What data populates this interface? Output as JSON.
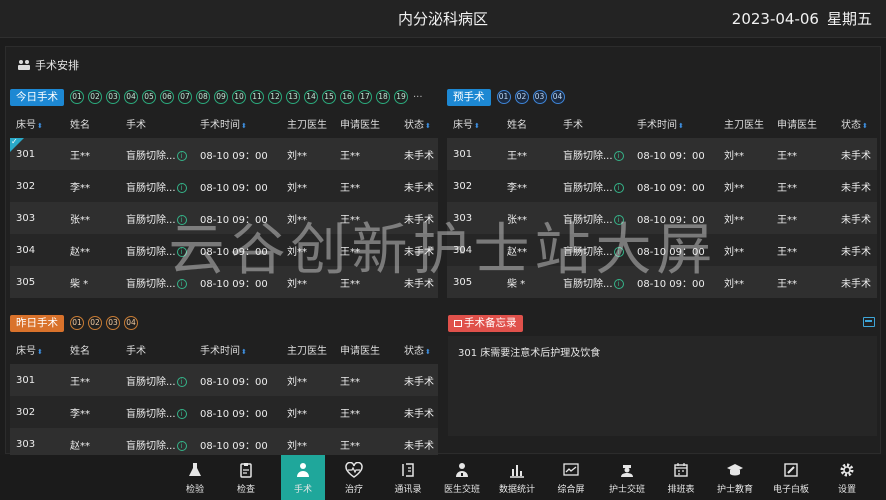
{
  "header": {
    "title": "内分泌科病区",
    "date": "2023-04-06",
    "weekday": "星期五"
  },
  "section_title": "手术安排",
  "columns": {
    "bed": "床号",
    "name": "姓名",
    "surgery": "手术",
    "time": "手术时间",
    "surgeon": "主刀医生",
    "applicant": "申请医生",
    "status": "状态"
  },
  "today": {
    "label": "今日手术",
    "pages": [
      "01",
      "02",
      "03",
      "04",
      "05",
      "06",
      "07",
      "08",
      "09",
      "10",
      "11",
      "12",
      "13",
      "14",
      "15",
      "16",
      "17",
      "18",
      "19"
    ],
    "more": "···",
    "rows": [
      {
        "bed": "301",
        "name": "王**",
        "surgery": "盲肠切除...",
        "time": "08-10 09：00",
        "surgeon": "刘**",
        "applicant": "王**",
        "status": "未手术"
      },
      {
        "bed": "302",
        "name": "李**",
        "surgery": "盲肠切除...",
        "time": "08-10 09：00",
        "surgeon": "刘**",
        "applicant": "王**",
        "status": "未手术"
      },
      {
        "bed": "303",
        "name": "张**",
        "surgery": "盲肠切除...",
        "time": "08-10 09：00",
        "surgeon": "刘**",
        "applicant": "王**",
        "status": "未手术"
      },
      {
        "bed": "304",
        "name": "赵**",
        "surgery": "盲肠切除...",
        "time": "08-10 09：00",
        "surgeon": "刘**",
        "applicant": "王**",
        "status": "未手术"
      },
      {
        "bed": "305",
        "name": "柴 *",
        "surgery": "盲肠切除...",
        "time": "08-10 09：00",
        "surgeon": "刘**",
        "applicant": "王**",
        "status": "未手术"
      }
    ]
  },
  "planned": {
    "label": "预手术",
    "pages": [
      "01",
      "02",
      "03",
      "04"
    ],
    "rows": [
      {
        "bed": "301",
        "name": "王**",
        "surgery": "盲肠切除...",
        "time": "08-10 09：00",
        "surgeon": "刘**",
        "applicant": "王**",
        "status": "未手术"
      },
      {
        "bed": "302",
        "name": "李**",
        "surgery": "盲肠切除...",
        "time": "08-10 09：00",
        "surgeon": "刘**",
        "applicant": "王**",
        "status": "未手术"
      },
      {
        "bed": "303",
        "name": "张**",
        "surgery": "盲肠切除...",
        "time": "08-10 09：00",
        "surgeon": "刘**",
        "applicant": "王**",
        "status": "未手术"
      },
      {
        "bed": "304",
        "name": "赵**",
        "surgery": "盲肠切除...",
        "time": "08-10 09：00",
        "surgeon": "刘**",
        "applicant": "王**",
        "status": "未手术"
      },
      {
        "bed": "305",
        "name": "柴 *",
        "surgery": "盲肠切除...",
        "time": "08-10 09：00",
        "surgeon": "刘**",
        "applicant": "王**",
        "status": "未手术"
      }
    ]
  },
  "yesterday": {
    "label": "昨日手术",
    "pages": [
      "01",
      "02",
      "03",
      "04"
    ],
    "rows": [
      {
        "bed": "301",
        "name": "王**",
        "surgery": "盲肠切除...",
        "time": "08-10 09：00",
        "surgeon": "刘**",
        "applicant": "王**",
        "status": "未手术"
      },
      {
        "bed": "302",
        "name": "李**",
        "surgery": "盲肠切除...",
        "time": "08-10 09：00",
        "surgeon": "刘**",
        "applicant": "王**",
        "status": "未手术"
      },
      {
        "bed": "303",
        "name": "赵**",
        "surgery": "盲肠切除...",
        "time": "08-10 09：00",
        "surgeon": "刘**",
        "applicant": "王**",
        "status": "未手术"
      }
    ]
  },
  "memo": {
    "label": "手术备忘录",
    "text": "301 床需要注意术后护理及饮食"
  },
  "watermark": "云谷创新护士站大屏",
  "nav": [
    {
      "id": "lab",
      "label": "检验",
      "icon": "flask-icon"
    },
    {
      "id": "exam",
      "label": "检查",
      "icon": "clipboard-icon"
    },
    {
      "id": "surgery",
      "label": "手术",
      "icon": "surgeon-icon",
      "active": true
    },
    {
      "id": "treatment",
      "label": "治疗",
      "icon": "heartbeat-icon"
    },
    {
      "id": "contacts",
      "label": "通讯录",
      "icon": "address-book-icon"
    },
    {
      "id": "doctor-handover",
      "label": "医生交班",
      "icon": "doctor-icon"
    },
    {
      "id": "stats",
      "label": "数据统计",
      "icon": "bar-chart-icon"
    },
    {
      "id": "overview",
      "label": "综合屏",
      "icon": "line-chart-icon"
    },
    {
      "id": "nurse-handover",
      "label": "护士交班",
      "icon": "nurse-icon"
    },
    {
      "id": "schedule",
      "label": "排班表",
      "icon": "calendar-icon"
    },
    {
      "id": "education",
      "label": "护士教育",
      "icon": "graduation-cap-icon"
    },
    {
      "id": "whiteboard",
      "label": "电子白板",
      "icon": "pen-board-icon"
    },
    {
      "id": "settings",
      "label": "设置",
      "icon": "gear-icon"
    }
  ],
  "colors": {
    "accent_blue": "#1d88d3",
    "accent_orange": "#d9722b",
    "accent_red": "#e0514b",
    "active_nav": "#1fa79b"
  }
}
